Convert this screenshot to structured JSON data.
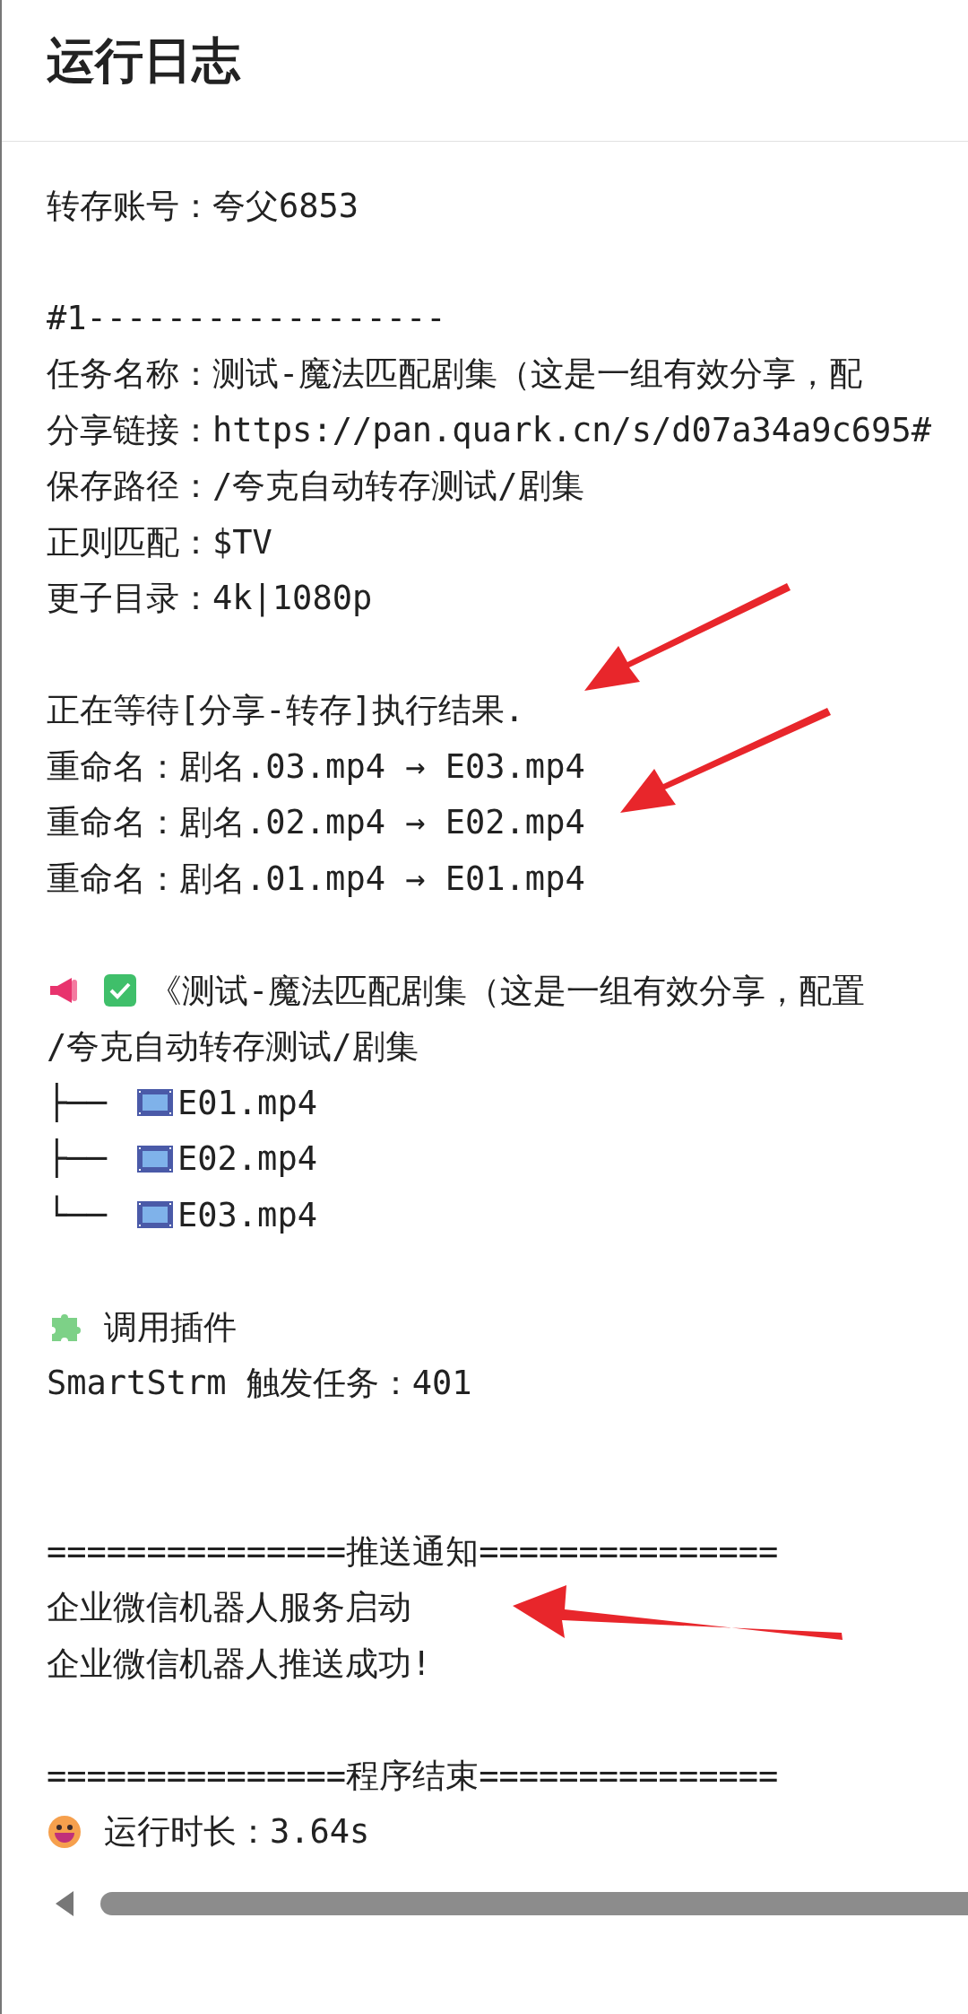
{
  "title": "运行日志",
  "log": [
    {
      "kind": "text",
      "text": "转存账号：夸父6853"
    },
    {
      "kind": "blank"
    },
    {
      "kind": "text",
      "text": "#1------------------"
    },
    {
      "kind": "text",
      "text": "任务名称：测试-魔法匹配剧集（这是一组有效分享，配"
    },
    {
      "kind": "text",
      "text": "分享链接：https://pan.quark.cn/s/d07a34a9c695#"
    },
    {
      "kind": "text",
      "text": "保存路径：/夸克自动转存测试/剧集"
    },
    {
      "kind": "text",
      "text": "正则匹配：$TV"
    },
    {
      "kind": "text",
      "text": "更子目录：4k|1080p"
    },
    {
      "kind": "blank"
    },
    {
      "kind": "text",
      "text": "正在等待[分享-转存]执行结果."
    },
    {
      "kind": "text",
      "text": "重命名：剧名.03.mp4 → E03.mp4"
    },
    {
      "kind": "text",
      "text": "重命名：剧名.02.mp4 → E02.mp4"
    },
    {
      "kind": "text",
      "text": "重命名：剧名.01.mp4 → E01.mp4"
    },
    {
      "kind": "blank"
    },
    {
      "kind": "notice",
      "text": "《测试-魔法匹配剧集（这是一组有效分享，配置"
    },
    {
      "kind": "text",
      "text": "/夸克自动转存测试/剧集"
    },
    {
      "kind": "tree",
      "branch": "├──",
      "text": "E01.mp4"
    },
    {
      "kind": "tree",
      "branch": "├──",
      "text": "E02.mp4"
    },
    {
      "kind": "tree",
      "branch": "└──",
      "text": "E03.mp4"
    },
    {
      "kind": "blank"
    },
    {
      "kind": "plugin",
      "text": "调用插件"
    },
    {
      "kind": "text",
      "text": "SmartStrm 触发任务：401"
    },
    {
      "kind": "blank"
    },
    {
      "kind": "blank"
    },
    {
      "kind": "text",
      "text": "===============推送通知==============="
    },
    {
      "kind": "text",
      "text": "企业微信机器人服务启动"
    },
    {
      "kind": "text",
      "text": "企业微信机器人推送成功!"
    },
    {
      "kind": "blank"
    },
    {
      "kind": "text",
      "text": "===============程序结束==============="
    },
    {
      "kind": "duration",
      "text": "运行时长：3.64s"
    }
  ]
}
